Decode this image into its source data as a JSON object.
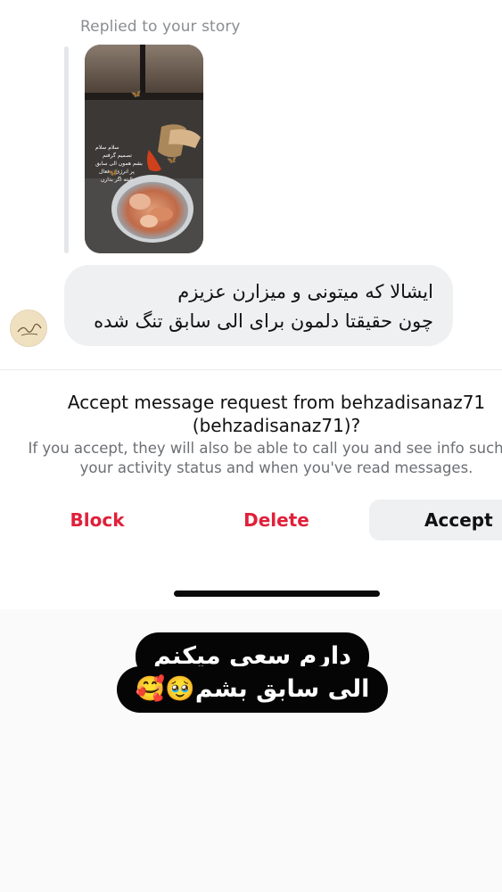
{
  "conversation": {
    "replied_label": "Replied to your story",
    "story_overlay_lines": [
      "سلام سلام",
      "تصمیم گرفتم",
      "بشم همون الی سابق",
      "پر انرژی و فعال",
      "البته اگر بذارن"
    ],
    "message_lines": [
      "ایشالا که میتونی و میزارن عزیزم",
      "چون حقیقتا دلمون برای الی سابق تنگ شده"
    ]
  },
  "request": {
    "title_line1": "Accept message request from behzadisanaz71",
    "title_line2": "(behzadisanaz71)?",
    "info_line1": "If you accept, they will also be able to call you and see info such as",
    "info_line2": "your activity status and when you've read messages."
  },
  "actions": {
    "block": "Block",
    "delete": "Delete",
    "accept": "Accept"
  },
  "caption": {
    "line1": "دارم سعی میکنم",
    "line2": "الی سابق بشم🥹🥰"
  },
  "colors": {
    "destructive": "#e0203a",
    "bubble": "#eff0f2",
    "caption_bg": "#050505"
  }
}
